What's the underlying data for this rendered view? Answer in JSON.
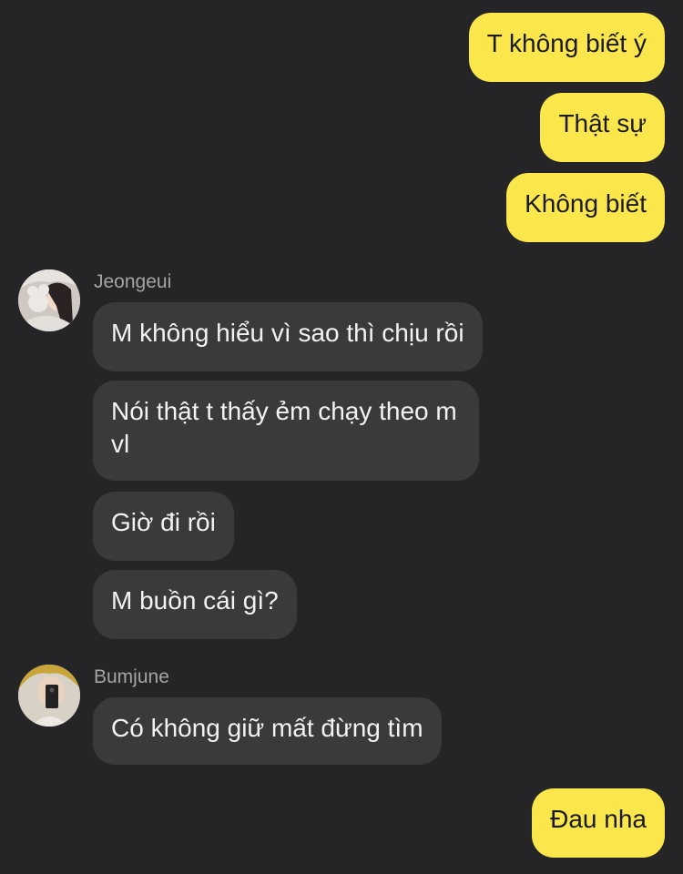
{
  "conversation": {
    "messages": [
      {
        "id": "m1",
        "direction": "outgoing",
        "text": "T không biết ý"
      },
      {
        "id": "m2",
        "direction": "outgoing",
        "text": "Thật sự"
      },
      {
        "id": "m3",
        "direction": "outgoing",
        "text": "Không biết"
      },
      {
        "id": "m4",
        "direction": "incoming",
        "sender": "Jeongeui",
        "text": "M không hiểu vì sao thì chịu rồi"
      },
      {
        "id": "m5",
        "direction": "incoming",
        "sender": "Jeongeui",
        "text": "Nói thật t thấy ẻm chạy theo m vl"
      },
      {
        "id": "m6",
        "direction": "incoming",
        "sender": "Jeongeui",
        "text": "Giờ đi rồi"
      },
      {
        "id": "m7",
        "direction": "incoming",
        "sender": "Jeongeui",
        "text": "M buồn cái gì?"
      },
      {
        "id": "m8",
        "direction": "incoming",
        "sender": "Bumjune",
        "text": "Có không giữ mất đừng tìm"
      },
      {
        "id": "m9",
        "direction": "outgoing",
        "text": "Đau nha"
      }
    ],
    "senders": {
      "jeongeui": "Jeongeui",
      "bumjune": "Bumjune"
    }
  },
  "colors": {
    "background": "#252527",
    "outgoing_bubble": "#fbe74b",
    "incoming_bubble": "#3a3a3c",
    "sender_name": "#a4a4a8"
  }
}
